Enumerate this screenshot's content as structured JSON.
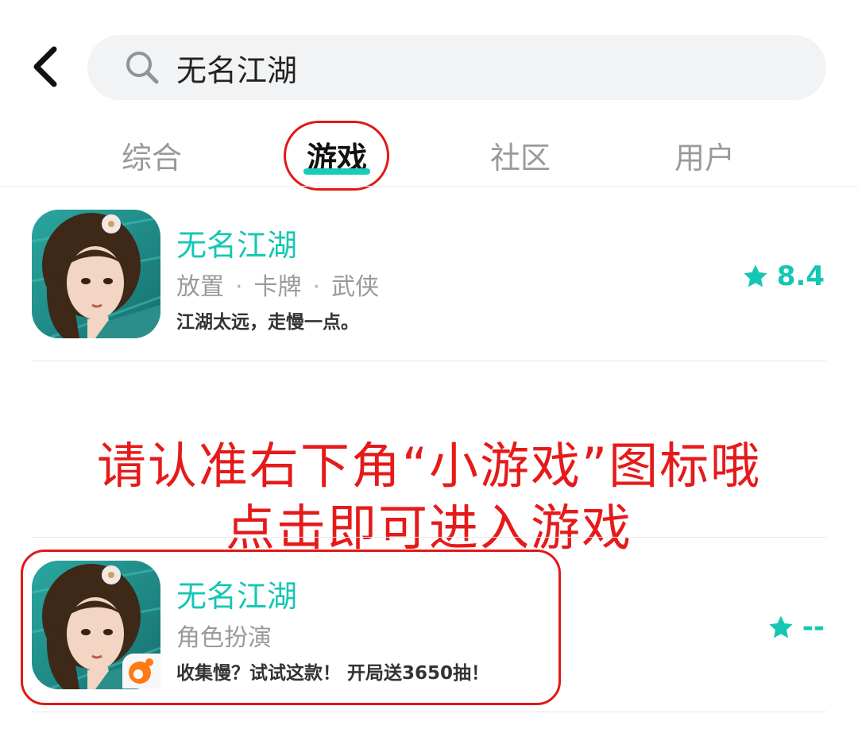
{
  "search": {
    "query": "无名江湖"
  },
  "tabs": [
    {
      "label": "综合"
    },
    {
      "label": "游戏"
    },
    {
      "label": "社区"
    },
    {
      "label": "用户"
    }
  ],
  "results": [
    {
      "name": "无名江湖",
      "tags": [
        "放置",
        "卡牌",
        "武侠"
      ],
      "description": "江湖太远，走慢一点。",
      "rating": "8.4"
    },
    {
      "name": "无名江湖",
      "tags": [
        "角色扮演"
      ],
      "description": "收集慢？试试这款！ 开局送3650抽！",
      "rating": "--"
    }
  ],
  "notice": {
    "line1": "请认准右下角“小游戏”图标哦",
    "line2": "点击即可进入游戏"
  },
  "colors": {
    "accent": "#14c7b3",
    "annotation": "#e21818"
  }
}
